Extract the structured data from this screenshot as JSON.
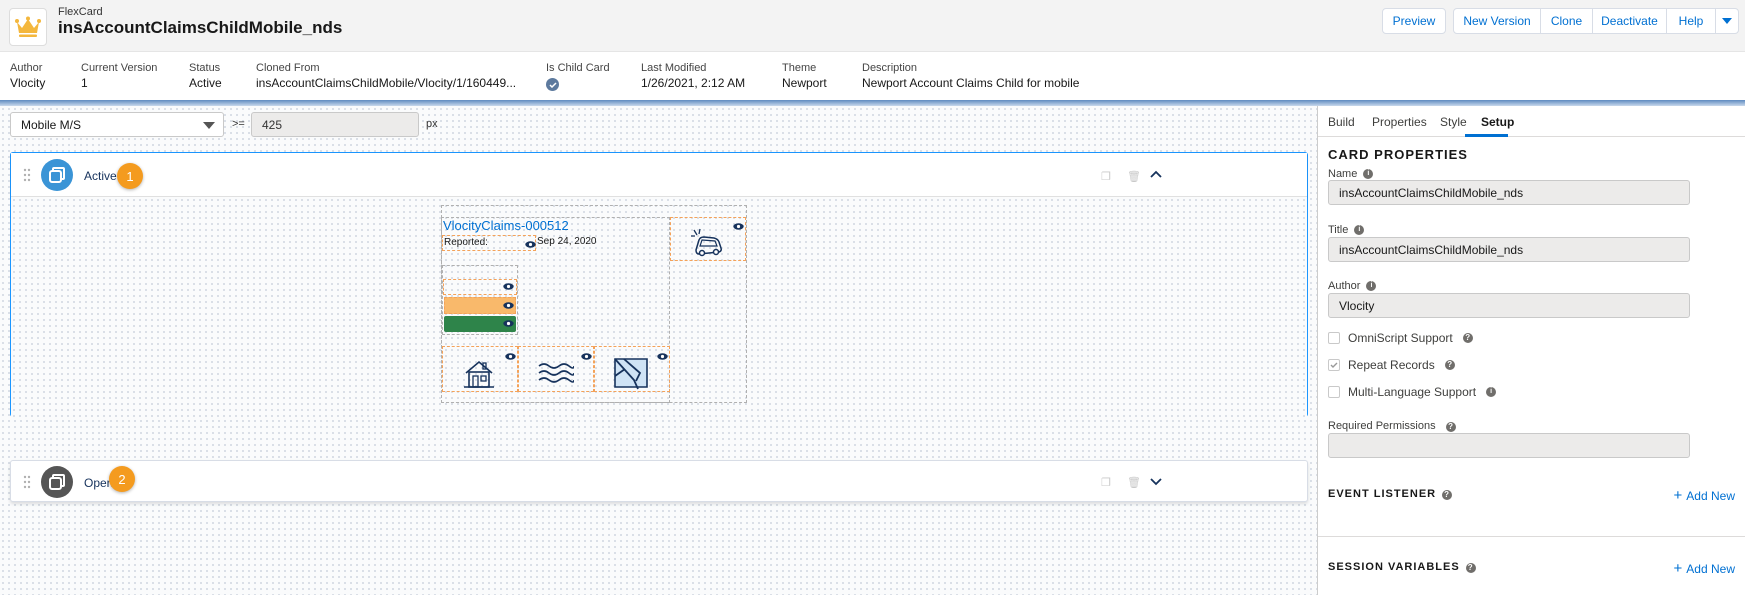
{
  "header": {
    "object_type": "FlexCard",
    "title": "insAccountClaimsChildMobile_nds",
    "buttons": {
      "preview": "Preview",
      "new_version": "New Version",
      "clone": "Clone",
      "deactivate": "Deactivate",
      "help": "Help"
    }
  },
  "meta": [
    {
      "label": "Author",
      "value": "Vlocity"
    },
    {
      "label": "Current Version",
      "value": "1"
    },
    {
      "label": "Status",
      "value": "Active"
    },
    {
      "label": "Cloned From",
      "value": "insAccountClaimsChildMobile/Vlocity/1/160449..."
    },
    {
      "label": "Is Child Card",
      "value": ""
    },
    {
      "label": "Last Modified",
      "value": "1/26/2021, 2:12 AM"
    },
    {
      "label": "Theme",
      "value": "Newport"
    },
    {
      "label": "Description",
      "value": "Newport Account Claims Child for mobile"
    }
  ],
  "toolbar": {
    "device": "Mobile M/S",
    "operator": ">=",
    "width_value": "425",
    "unit": "px"
  },
  "states": [
    {
      "label": "Active",
      "badge": "1",
      "color": "#3a94d6"
    },
    {
      "label": "Open",
      "badge": "2",
      "color": "#555555"
    }
  ],
  "card_preview": {
    "claim_name": "VlocityClaims-000512",
    "reported_label": "Reported:",
    "reported_date": "Sep 24, 2020",
    "icons": [
      "car-accident-icon",
      "house-icon",
      "flood-icon",
      "map-icon"
    ],
    "bar_colors": {
      "orange": "#f9b96b",
      "green": "#2e844a"
    }
  },
  "panel": {
    "tabs": [
      "Build",
      "Properties",
      "Style",
      "Setup"
    ],
    "active_tab": "Setup",
    "card_properties_title": "CARD PROPERTIES",
    "name_label": "Name",
    "name_value": "insAccountClaimsChildMobile_nds",
    "title_label": "Title",
    "title_value": "insAccountClaimsChildMobile_nds",
    "author_label": "Author",
    "author_value": "Vlocity",
    "checkboxes": [
      {
        "label": "OmniScript Support",
        "checked": false
      },
      {
        "label": "Repeat Records",
        "checked": true
      },
      {
        "label": "Multi-Language Support",
        "checked": false
      }
    ],
    "required_permissions_label": "Required Permissions",
    "required_permissions_value": "",
    "event_listener_title": "EVENT LISTENER",
    "session_variables_title": "SESSION VARIABLES",
    "add_new": "Add New"
  },
  "colors": {
    "accent": "#0070d2",
    "badge": "#f49b1f",
    "icon_navy": "#16325c"
  }
}
